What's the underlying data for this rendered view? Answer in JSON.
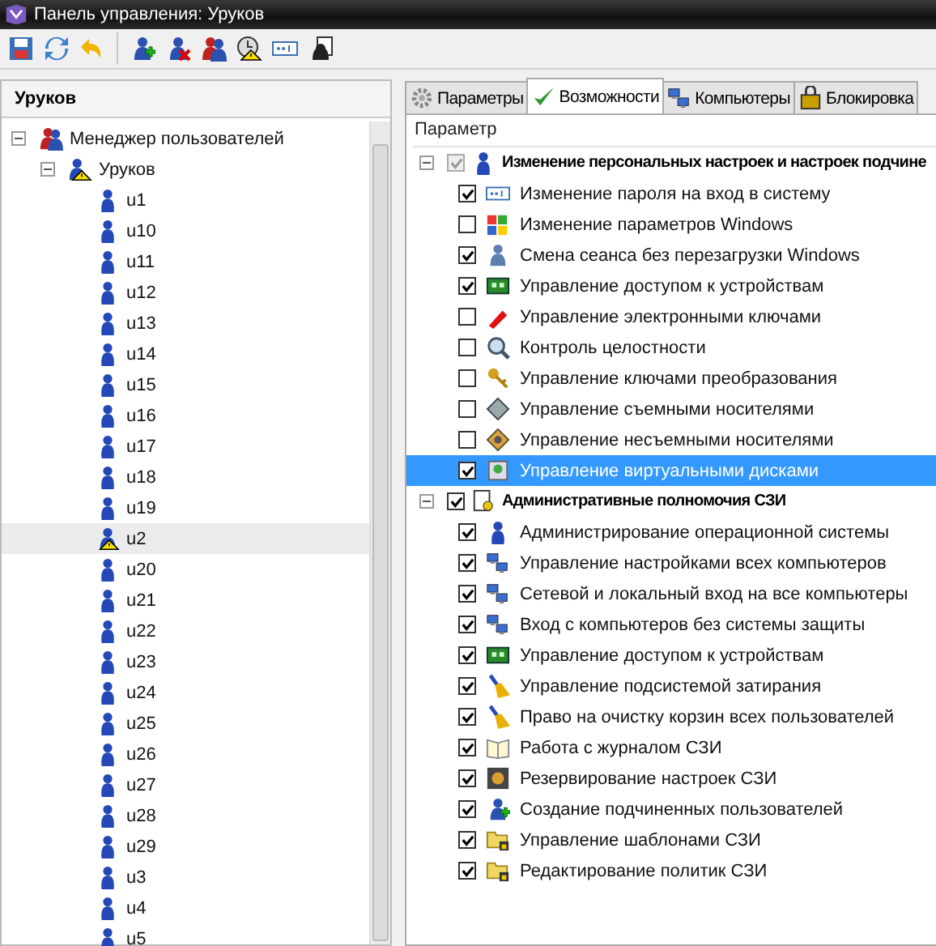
{
  "window": {
    "title": "Панель управления: Уруков"
  },
  "toolbar": [
    {
      "kind": "save"
    },
    {
      "kind": "refresh"
    },
    {
      "kind": "undo"
    },
    {
      "kind": "user-add"
    },
    {
      "kind": "user-remove"
    },
    {
      "kind": "users"
    },
    {
      "kind": "clock-warning"
    },
    {
      "kind": "password"
    },
    {
      "kind": "user-doc"
    }
  ],
  "left_panel": {
    "title": "Уруков",
    "tree": [
      {
        "label": "Менеджер пользователей",
        "kind": "users",
        "expanded": true,
        "selected": false,
        "children": [
          {
            "label": "Уруков",
            "kind": "group-warning",
            "expanded": true,
            "selected": false,
            "children": [
              {
                "label": "u1",
                "kind": "user",
                "selected": false
              },
              {
                "label": "u10",
                "kind": "user",
                "selected": false
              },
              {
                "label": "u11",
                "kind": "user",
                "selected": false
              },
              {
                "label": "u12",
                "kind": "user",
                "selected": false
              },
              {
                "label": "u13",
                "kind": "user",
                "selected": false
              },
              {
                "label": "u14",
                "kind": "user",
                "selected": false
              },
              {
                "label": "u15",
                "kind": "user",
                "selected": false
              },
              {
                "label": "u16",
                "kind": "user",
                "selected": false
              },
              {
                "label": "u17",
                "kind": "user",
                "selected": false
              },
              {
                "label": "u18",
                "kind": "user",
                "selected": false
              },
              {
                "label": "u19",
                "kind": "user",
                "selected": false
              },
              {
                "label": "u2",
                "kind": "user-warning",
                "selected": true
              },
              {
                "label": "u20",
                "kind": "user",
                "selected": false
              },
              {
                "label": "u21",
                "kind": "user",
                "selected": false
              },
              {
                "label": "u22",
                "kind": "user",
                "selected": false
              },
              {
                "label": "u23",
                "kind": "user",
                "selected": false
              },
              {
                "label": "u24",
                "kind": "user",
                "selected": false
              },
              {
                "label": "u25",
                "kind": "user",
                "selected": false
              },
              {
                "label": "u26",
                "kind": "user",
                "selected": false
              },
              {
                "label": "u27",
                "kind": "user",
                "selected": false
              },
              {
                "label": "u28",
                "kind": "user",
                "selected": false
              },
              {
                "label": "u29",
                "kind": "user",
                "selected": false
              },
              {
                "label": "u3",
                "kind": "user",
                "selected": false
              },
              {
                "label": "u4",
                "kind": "user",
                "selected": false
              },
              {
                "label": "u5",
                "kind": "user",
                "selected": false
              }
            ]
          }
        ]
      }
    ]
  },
  "tabs": [
    {
      "label": "Параметры",
      "kind": "gear",
      "selected": false
    },
    {
      "label": "Возможности",
      "kind": "check",
      "selected": true
    },
    {
      "label": "Компьютеры",
      "kind": "computer",
      "selected": false
    },
    {
      "label": "Блокировка",
      "kind": "lock",
      "selected": false
    }
  ],
  "table": {
    "column": "Параметр",
    "groups": [
      {
        "label": "Изменение персональных настроек и настроек подчине",
        "kind": "user",
        "expanded": true,
        "checked": true,
        "disabled": true,
        "items": [
          {
            "label": "Изменение пароля на вход в систему",
            "kind": "password",
            "checked": true,
            "selected": false
          },
          {
            "label": "Изменение параметров Windows",
            "kind": "windows",
            "checked": false,
            "selected": false
          },
          {
            "label": "Смена сеанса без перезагрузки Windows",
            "kind": "user-swap",
            "checked": true,
            "selected": false
          },
          {
            "label": "Управление доступом к устройствам",
            "kind": "chip",
            "checked": true,
            "selected": false
          },
          {
            "label": "Управление электронными ключами",
            "kind": "usb-key",
            "checked": false,
            "selected": false
          },
          {
            "label": "Контроль целостности",
            "kind": "magnifier",
            "checked": false,
            "selected": false
          },
          {
            "label": "Управление ключами преобразования",
            "kind": "key",
            "checked": false,
            "selected": false
          },
          {
            "label": "Управление съемными носителями",
            "kind": "diamond",
            "checked": false,
            "selected": false
          },
          {
            "label": "Управление несъемными носителями",
            "kind": "disk",
            "checked": false,
            "selected": false
          },
          {
            "label": "Управление виртуальными дисками",
            "kind": "drive",
            "checked": true,
            "selected": true
          }
        ]
      },
      {
        "label": "Административные полномочия СЗИ",
        "kind": "doc-key",
        "expanded": true,
        "checked": true,
        "disabled": false,
        "items": [
          {
            "label": "Администрирование операционной системы",
            "kind": "user",
            "checked": true,
            "selected": false
          },
          {
            "label": "Управление настройками всех компьютеров",
            "kind": "computers",
            "checked": true,
            "selected": false
          },
          {
            "label": "Сетевой и локальный вход на все компьютеры",
            "kind": "computers",
            "checked": true,
            "selected": false
          },
          {
            "label": "Вход с компьютеров без системы защиты",
            "kind": "computers",
            "checked": true,
            "selected": false
          },
          {
            "label": "Управление доступом к устройствам",
            "kind": "chip",
            "checked": true,
            "selected": false
          },
          {
            "label": "Управление подсистемой затирания",
            "kind": "broom",
            "checked": true,
            "selected": false
          },
          {
            "label": "Право на очистку корзин всех пользователей",
            "kind": "broom",
            "checked": true,
            "selected": false
          },
          {
            "label": "Работа с журналом СЗИ",
            "kind": "book",
            "checked": true,
            "selected": false
          },
          {
            "label": "Резервирование настроек СЗИ",
            "kind": "backup",
            "checked": true,
            "selected": false
          },
          {
            "label": "Создание подчиненных пользователей",
            "kind": "user-add",
            "checked": true,
            "selected": false
          },
          {
            "label": "Управление шаблонами СЗИ",
            "kind": "folder-lock",
            "checked": true,
            "selected": false
          },
          {
            "label": "Редактирование политик СЗИ",
            "kind": "folder-lock",
            "checked": true,
            "selected": false
          }
        ]
      }
    ]
  }
}
